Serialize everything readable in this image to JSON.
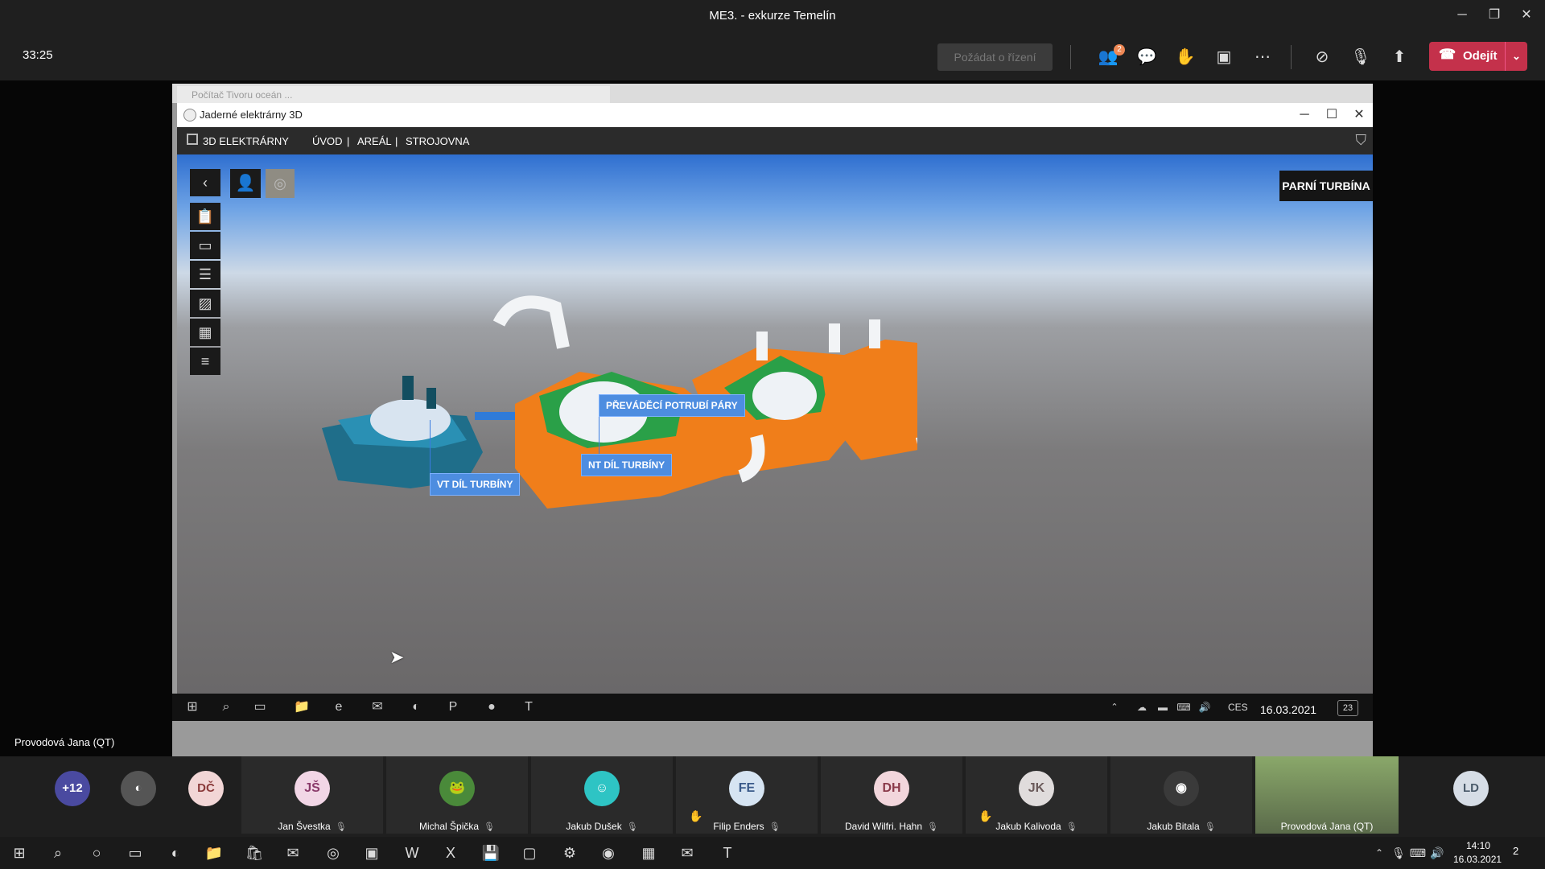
{
  "window": {
    "title": "ME3. - exkurze Temelín",
    "minimize": "─",
    "restore": "❐",
    "close": "✕"
  },
  "meeting": {
    "timer": "33:25",
    "request_control": "Požádat o řízení",
    "participants_badge": "2",
    "leave_label": "Odejít",
    "icons": [
      "participants-icon",
      "chat-icon",
      "reactions-icon",
      "rooms-icon",
      "more-icon",
      "camera-off-icon",
      "mic-off-icon",
      "share-icon"
    ]
  },
  "shared": {
    "presenter": "Provodová Jana (QT)",
    "browser_tab": "Počítač Tivoru oceán ...",
    "app": {
      "title": "Jaderné elektrárny 3D",
      "brand": "3D ELEKTRÁRNY",
      "nav": [
        "ÚVOD",
        "|",
        "AREÁL",
        "|",
        "STROJOVNA"
      ],
      "section_title": "PARNÍ TURBÍNA",
      "labels": {
        "pipe": "PŘEVÁDĚCÍ POTRUBÍ PÁRY",
        "lp": "NT DÍL TURBÍNY",
        "hp": "VT DÍL TURBÍNY"
      }
    },
    "inner_taskbar": {
      "lang": "CES",
      "date": "16.03.2021",
      "notifications": "23"
    }
  },
  "participants": {
    "overflow": "+12",
    "tiles": [
      {
        "initials": "DČ",
        "name": "",
        "color": "#f2d6d6",
        "text_color": "#8a3a3a"
      },
      {
        "initials": "JŠ",
        "name": "Jan Švestka",
        "color": "#f2d6e6",
        "text_color": "#8a3a6a"
      },
      {
        "initials": "",
        "name": "Michal Špička",
        "color": "#4a8a3a",
        "text_color": "#fff"
      },
      {
        "initials": "",
        "name": "Jakub Dušek",
        "color": "#2ec4c4",
        "text_color": "#fff"
      },
      {
        "initials": "FE",
        "name": "Filip Enders",
        "color": "#d6e4f2",
        "text_color": "#3a5a8a"
      },
      {
        "initials": "DH",
        "name": "David Wilfri. Hahn",
        "color": "#f2d6dc",
        "text_color": "#8a3a4a"
      },
      {
        "initials": "JK",
        "name": "Jakub Kalivoda",
        "color": "#e0dcdc",
        "text_color": "#6a5a5a"
      },
      {
        "initials": "",
        "name": "Jakub Bitala",
        "color": "#3a3a3a",
        "text_color": "#fff"
      },
      {
        "initials": "",
        "name": "Provodová Jana (QT)",
        "color": "#5a6a4a",
        "text_color": "#fff"
      },
      {
        "initials": "LD",
        "name": "",
        "color": "#d6dde6",
        "text_color": "#4a5a6a"
      }
    ]
  },
  "taskbar": {
    "time": "14:10",
    "date": "16.03.2021",
    "notifications": "2"
  }
}
